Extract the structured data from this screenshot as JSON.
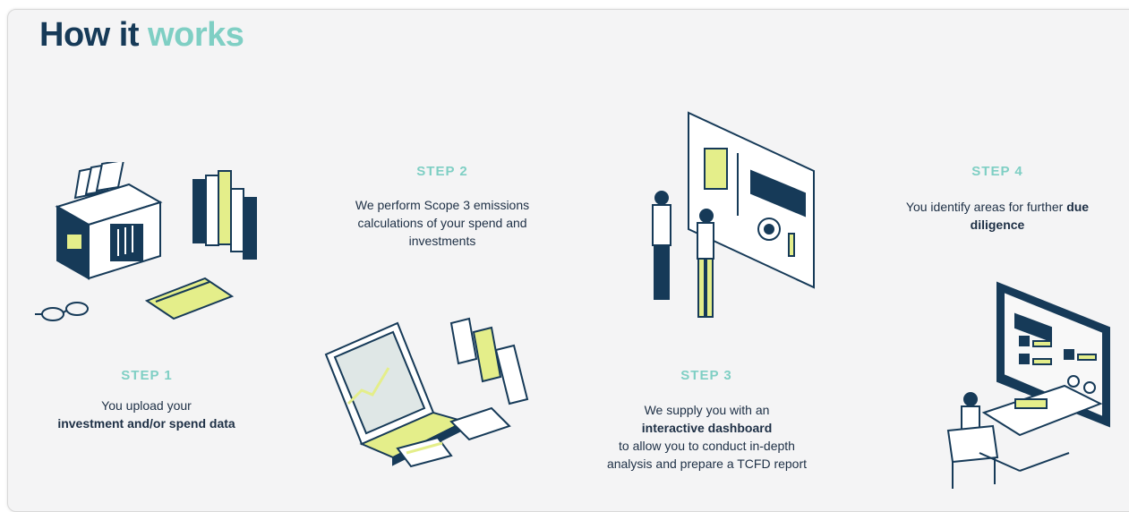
{
  "title": {
    "part1": "How it",
    "part2": "works"
  },
  "steps": [
    {
      "label": "STEP 1",
      "text_pre": "You upload your",
      "text_bold": "investment and/or spend data",
      "text_post": ""
    },
    {
      "label": "STEP 2",
      "text_pre": "We perform Scope 3 emissions calculations of your spend and investments",
      "text_bold": "",
      "text_post": ""
    },
    {
      "label": "STEP 3",
      "text_pre": "We supply you with an",
      "text_bold": "interactive dashboard",
      "text_post": "to allow you to conduct in-depth analysis and prepare a TCFD report"
    },
    {
      "label": "STEP 4",
      "text_pre": "You identify areas for further",
      "text_bold": "due diligence",
      "text_post": ""
    }
  ],
  "colors": {
    "navy": "#163a58",
    "teal": "#7fcfc4",
    "yellow": "#e4ee8a",
    "background": "#f4f4f5"
  },
  "illustrations": [
    "files-box-icon",
    "laptop-icon",
    "dashboard-people-icon",
    "monitor-desk-icon"
  ]
}
